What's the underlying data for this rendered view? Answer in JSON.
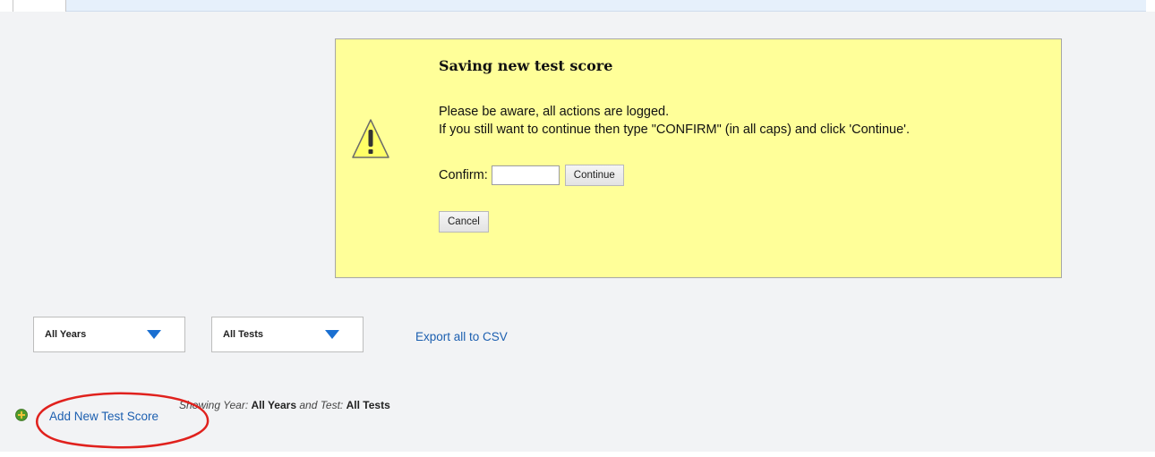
{
  "dialog": {
    "title": "Saving new test score",
    "message_line1": "Please be aware, all actions are logged.",
    "message_line2": "If you still want to continue then type \"CONFIRM\" (in all caps) and click 'Continue'.",
    "confirm_label": "Confirm:",
    "confirm_value": "",
    "continue_label": "Continue",
    "cancel_label": "Cancel",
    "icon": "warning-icon"
  },
  "filters": {
    "years_selected": "All Years",
    "tests_selected": "All Tests",
    "export_label": "Export all to CSV"
  },
  "footer": {
    "add_label": "Add New Test Score",
    "showing_year_label": "Showing Year:",
    "showing_year_value": "All Years",
    "showing_and_test_label": "and Test:",
    "showing_test_value": "All Tests",
    "add_icon": "add-icon"
  },
  "colors": {
    "dialog_bg": "#ffff99",
    "link": "#1c5fb0",
    "arrow": "#1a6fd1",
    "highlight": "#e0211d"
  }
}
